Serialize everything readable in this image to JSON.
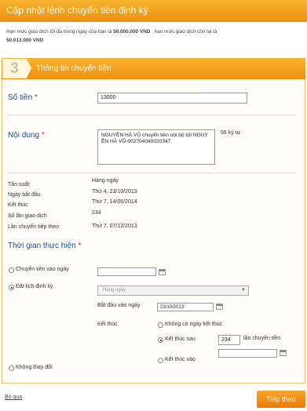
{
  "header": {
    "title": "Cập nhật lệnh chuyển tiền định kỳ"
  },
  "limit_note": {
    "p1": "Hạn mức giao dịch tối đa trong ngày của bạn là ",
    "max_amount": "50.000.000 VND",
    "p2": " , hạn mức giao dịch còn lại là ",
    "remaining_amount": "50.013.000 VND"
  },
  "step": {
    "number": "3",
    "title": "Thông tin chuyển tiền"
  },
  "amount": {
    "label": "Số tiền",
    "required": "*",
    "value": "13000"
  },
  "content": {
    "label": "Nội dung",
    "required": "*",
    "value": "NGUYỄN HÀ VŨ chuyển tiền nội bộ tới NGUYỄN HÀ VŨ-002704040020347",
    "char_count": "56",
    "char_unit": "ký tự"
  },
  "info": [
    {
      "label": "Tần suất",
      "value": "Hàng ngày"
    },
    {
      "label": "Ngày bắt đầu",
      "value": "Thứ 4, 23/10/2013"
    },
    {
      "label": "Kết thúc",
      "value": "Thứ 7, 14/06/2014"
    },
    {
      "label": "Số lần giao dịch",
      "value": "234"
    },
    {
      "label": "Lần chuyển tiếp theo",
      "value": "Thứ 7, 07/12/2013"
    }
  ],
  "schedule": {
    "label": "Thời gian thực hiện",
    "required": "*",
    "option_date": "Chuyển tiền vào ngày",
    "option_schedule": "Đặt lịch định kỳ",
    "frequency_placeholder": "Hàng ngày",
    "start_label": "Bắt đầu vào ngày",
    "start_value": "23/10/2013",
    "end_label": "Kết thúc",
    "end_none": "Không có ngày kết thúc",
    "end_after": "Kết thúc sau",
    "end_after_value": "234",
    "end_after_unit": "lần chuyển tiền",
    "end_on": "Kết thúc vào",
    "no_change": "Không thay đổi"
  },
  "footer": {
    "skip": "Bỏ qua",
    "next": "Tiếp theo"
  },
  "colors": {
    "accent": "#f19a1c",
    "label_blue": "#1c4e8e",
    "required_red": "#d9261c"
  }
}
